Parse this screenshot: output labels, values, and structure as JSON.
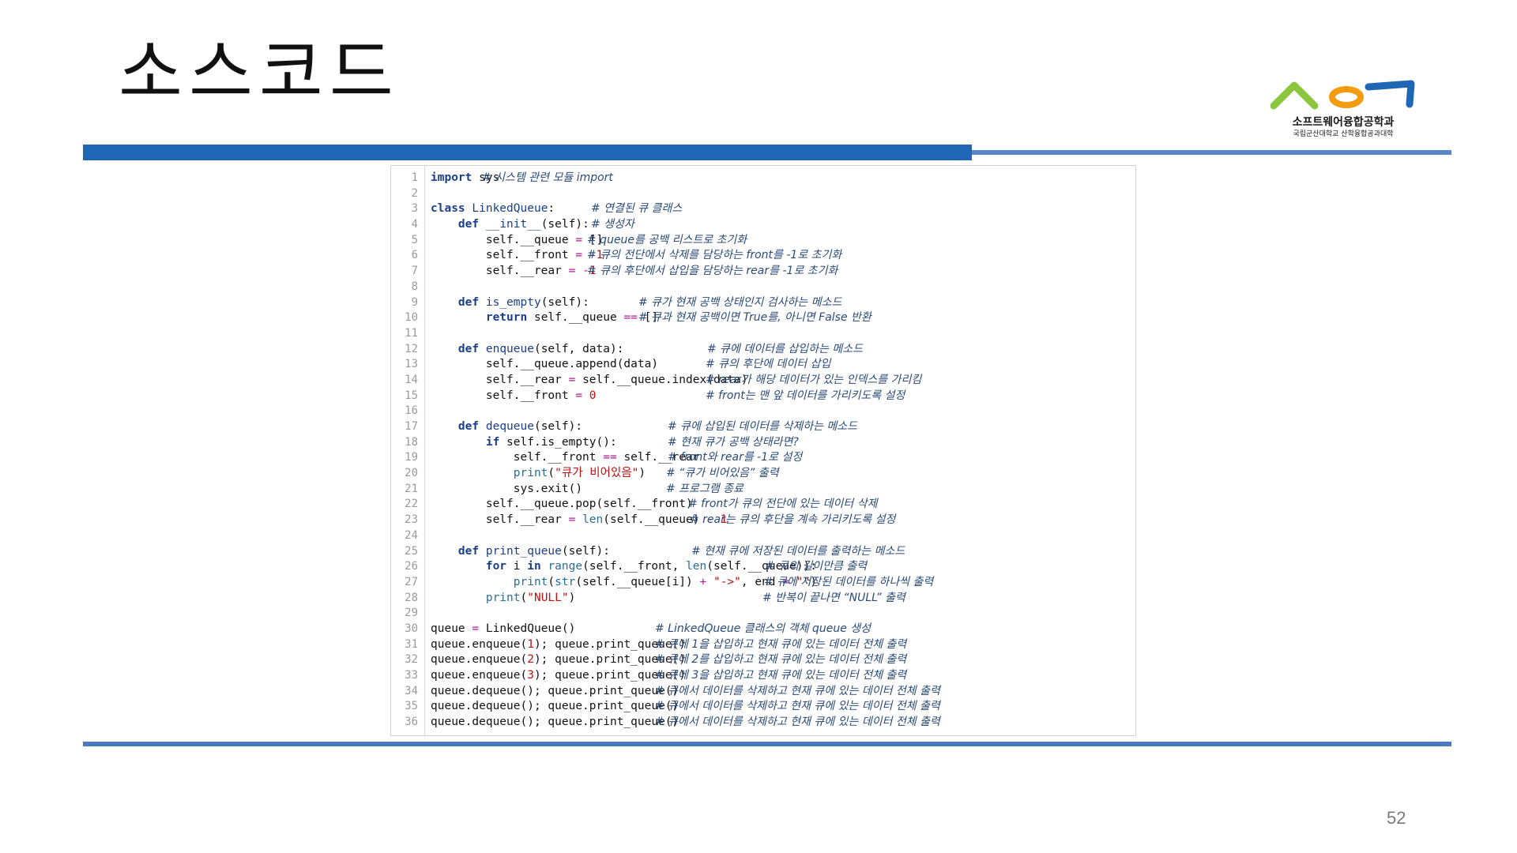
{
  "slide": {
    "title": "소스코드",
    "page_number": "52"
  },
  "logo": {
    "name": "소프트웨어융합공학과",
    "subtitle": "국립군산대학교 산학융합공과대학",
    "colors": [
      "#8cc63f",
      "#f39c12",
      "#1f67b4"
    ]
  },
  "colors": {
    "title_bar": "#1f67b4",
    "divider": "#4b78c0",
    "keyword": "#1a3f8a",
    "string": "#c01010",
    "comment": "#2a4a78"
  },
  "code": {
    "language": "python",
    "lines": [
      {
        "n": "1",
        "code": "import sys",
        "comment": "# 시스템 관련 모듈 import"
      },
      {
        "n": "2",
        "code": "",
        "comment": ""
      },
      {
        "n": "3",
        "code": "class LinkedQueue:",
        "comment": "# 연결된 큐 클래스"
      },
      {
        "n": "4",
        "code": "    def __init__(self):",
        "comment": "# 생성자"
      },
      {
        "n": "5",
        "code": "        self.__queue = []",
        "comment": "# queue를 공백 리스트로 초기화"
      },
      {
        "n": "6",
        "code": "        self.__front = -1",
        "comment": "# 큐의 전단에서 삭제를 담당하는 front를 -1로 초기화"
      },
      {
        "n": "7",
        "code": "        self.__rear = -1",
        "comment": "# 큐의 후단에서 삽입을 담당하는 rear를 -1로 초기화"
      },
      {
        "n": "8",
        "code": "",
        "comment": ""
      },
      {
        "n": "9",
        "code": "    def is_empty(self):",
        "comment": "# 큐가 현재 공백 상태인지 검사하는 메소드"
      },
      {
        "n": "10",
        "code": "        return self.__queue == []",
        "comment": "# 큐과 현재 공백이면 True를, 아니면 False 반환"
      },
      {
        "n": "11",
        "code": "",
        "comment": ""
      },
      {
        "n": "12",
        "code": "    def enqueue(self, data):",
        "comment": "# 큐에 데이터를 삽입하는 메소드"
      },
      {
        "n": "13",
        "code": "        self.__queue.append(data)",
        "comment": "# 큐의 후단에 데이터 삽입"
      },
      {
        "n": "14",
        "code": "        self.__rear = self.__queue.index(data)",
        "comment": "# rear가 해당 데이터가 있는 인덱스를 가리킴"
      },
      {
        "n": "15",
        "code": "        self.__front = 0",
        "comment": "# front는 맨 앞 데이터를 가리키도록 설정"
      },
      {
        "n": "16",
        "code": "",
        "comment": ""
      },
      {
        "n": "17",
        "code": "    def dequeue(self):",
        "comment": "# 큐에 삽입된 데이터를 삭제하는 메소드"
      },
      {
        "n": "18",
        "code": "        if self.is_empty():",
        "comment": "# 현재 큐가 공백 상태라면?"
      },
      {
        "n": "19",
        "code": "            self.__front == self.__rear",
        "comment": "# front와 rear를 -1로 설정"
      },
      {
        "n": "20",
        "code": "            print(\"큐가 비어있음\")",
        "comment": "# “큐가 비어있음” 출력"
      },
      {
        "n": "21",
        "code": "            sys.exit()",
        "comment": "# 프로그램 종료"
      },
      {
        "n": "22",
        "code": "        self.__queue.pop(self.__front)",
        "comment": "# front가 큐의 전단에 있는 데이터 삭제"
      },
      {
        "n": "23",
        "code": "        self.__rear = len(self.__queue) - 1",
        "comment": "# rear는 큐의 후단을 계속 가리키도록 설정"
      },
      {
        "n": "24",
        "code": "",
        "comment": ""
      },
      {
        "n": "25",
        "code": "    def print_queue(self):",
        "comment": "# 현재 큐에 저장된 데이터를 출력하는 메소드"
      },
      {
        "n": "26",
        "code": "        for i in range(self.__front, len(self.__queue)):",
        "comment": "# 큐의 길이만큼 출력"
      },
      {
        "n": "27",
        "code": "            print(str(self.__queue[i]) + \"->\", end = \"\")",
        "comment": "# 큐에 저장된 데이터를 하나씩 출력"
      },
      {
        "n": "28",
        "code": "        print(\"NULL\")",
        "comment": "# 반복이 끝나면 “NULL” 출력"
      },
      {
        "n": "29",
        "code": "",
        "comment": ""
      },
      {
        "n": "30",
        "code": "queue = LinkedQueue()",
        "comment": "# LinkedQueue 클래스의 객체 queue 생성"
      },
      {
        "n": "31",
        "code": "queue.enqueue(1); queue.print_queue()",
        "comment": "# 큐에 1을 삽입하고 현재 큐에 있는 데이터 전체 출력"
      },
      {
        "n": "32",
        "code": "queue.enqueue(2); queue.print_queue()",
        "comment": "# 큐에 2를 삽입하고 현재 큐에 있는 데이터 전체 출력"
      },
      {
        "n": "33",
        "code": "queue.enqueue(3); queue.print_queue()",
        "comment": "# 큐에 3을 삽입하고 현재 큐에 있는 데이터 전체 출력"
      },
      {
        "n": "34",
        "code": "queue.dequeue(); queue.print_queue()",
        "comment": "# 큐에서 데이터를 삭제하고 현재 큐에 있는 데이터 전체 출력"
      },
      {
        "n": "35",
        "code": "queue.dequeue(); queue.print_queue()",
        "comment": "# 큐에서 데이터를 삭제하고 현재 큐에 있는 데이터 전체 출력"
      },
      {
        "n": "36",
        "code": "queue.dequeue(); queue.print_queue()",
        "comment": "# 큐에서 데이터를 삭제하고 현재 큐에 있는 데이터 전체 출력"
      }
    ]
  }
}
